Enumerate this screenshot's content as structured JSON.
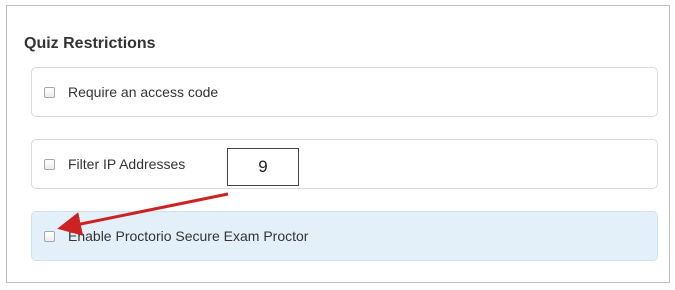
{
  "section": {
    "title": "Quiz Restrictions"
  },
  "options": [
    {
      "label": "Require an access code",
      "checked": false
    },
    {
      "label": "Filter IP Addresses",
      "checked": false
    },
    {
      "label": "Enable Proctorio Secure Exam Proctor",
      "checked": false,
      "highlighted": true
    }
  ],
  "annotation": {
    "callout_number": "9",
    "arrow_color": "#cc2222"
  },
  "colors": {
    "highlight_background": "#e3f0fa",
    "text": "#333333"
  }
}
